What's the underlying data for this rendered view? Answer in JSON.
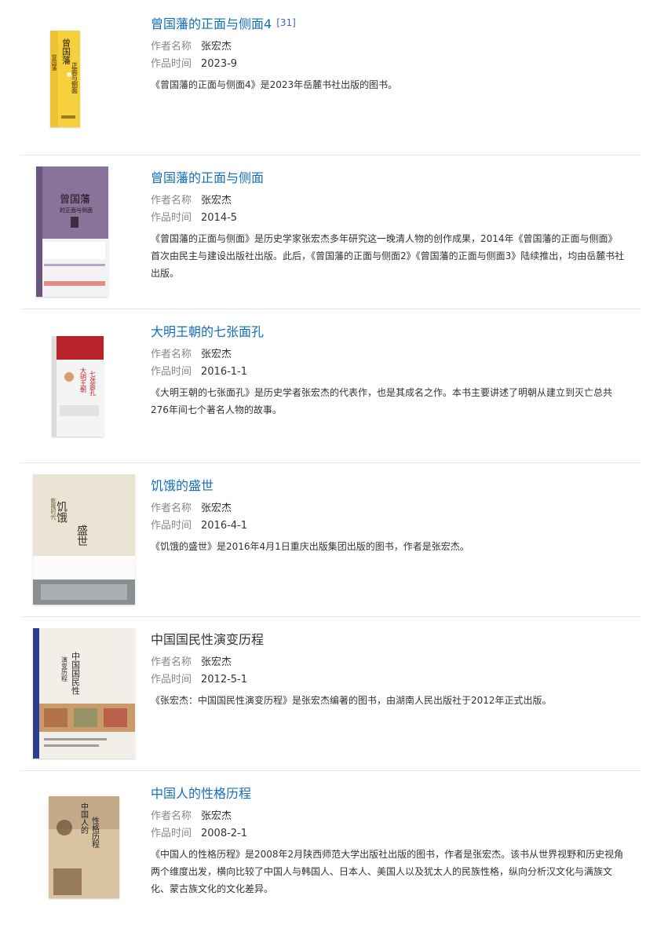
{
  "labels": {
    "author": "作者名称",
    "time": "作品时间"
  },
  "books": [
    {
      "title": "曾国藩的正面与侧面4",
      "ref": "[31]",
      "author": "张宏杰",
      "time": "2023-9",
      "desc": "《曾国藩的正面与侧面4》是2023年岳麓书社出版的图书。",
      "cover_text": "曾国藩的正面与侧面",
      "cover_color": "#f5cf3c"
    },
    {
      "title": "曾国藩的正面与侧面",
      "author": "张宏杰",
      "time": "2014-5",
      "desc": "《曾国藩的正面与侧面》是历史学家张宏杰多年研究这一晚清人物的创作成果，2014年《曾国藩的正面与侧面》首次由民主与建设出版社出版。此后，《曾国藩的正面与侧面2》《曾国藩的正面与侧面3》陆续推出，均由岳麓书社出版。",
      "cover_text": "曾国藩",
      "cover_subtitle": "的正面与侧面",
      "cover_color": "#7a5f86"
    },
    {
      "title": "大明王朝的七张面孔",
      "author": "张宏杰",
      "time": "2016-1-1",
      "desc": "《大明王朝的七张面孔》是历史学者张宏杰的代表作，也是其成名之作。本书主要讲述了明朝从建立到灭亡总共276年间七个著名人物的故事。",
      "cover_text": "大明王朝的七张面孔",
      "cover_color": "#b8232a"
    },
    {
      "title": "饥饿的盛世",
      "author": "张宏杰",
      "time": "2016-4-1",
      "desc": "《饥饿的盛世》是2016年4月1日重庆出版集团出版的图书，作者是张宏杰。",
      "cover_text": "饥饿的盛世",
      "cover_color": "#e9e4d4"
    },
    {
      "title": "中国国民性演变历程",
      "author": "张宏杰",
      "time": "2012-5-1",
      "desc": "《张宏杰：中国国民性演变历程》是张宏杰编著的图书，由湖南人民出版社于2012年正式出版。",
      "cover_text": "中国国民性",
      "cover_subtitle": "演变历程",
      "cover_color": "#f2efe8"
    },
    {
      "title": "中国人的性格历程",
      "author": "张宏杰",
      "time": "2008-2-1",
      "desc": "《中国人的性格历程》是2008年2月陕西师范大学出版社出版的图书，作者是张宏杰。该书从世界视野和历史视角两个维度出发，横向比较了中国人与韩国人、日本人、美国人以及犹太人的民族性格，纵向分析汉文化与满族文化、蒙古族文化的文化差异。",
      "cover_text": "中国人的性格历程",
      "cover_color": "#d9c3a0"
    }
  ]
}
